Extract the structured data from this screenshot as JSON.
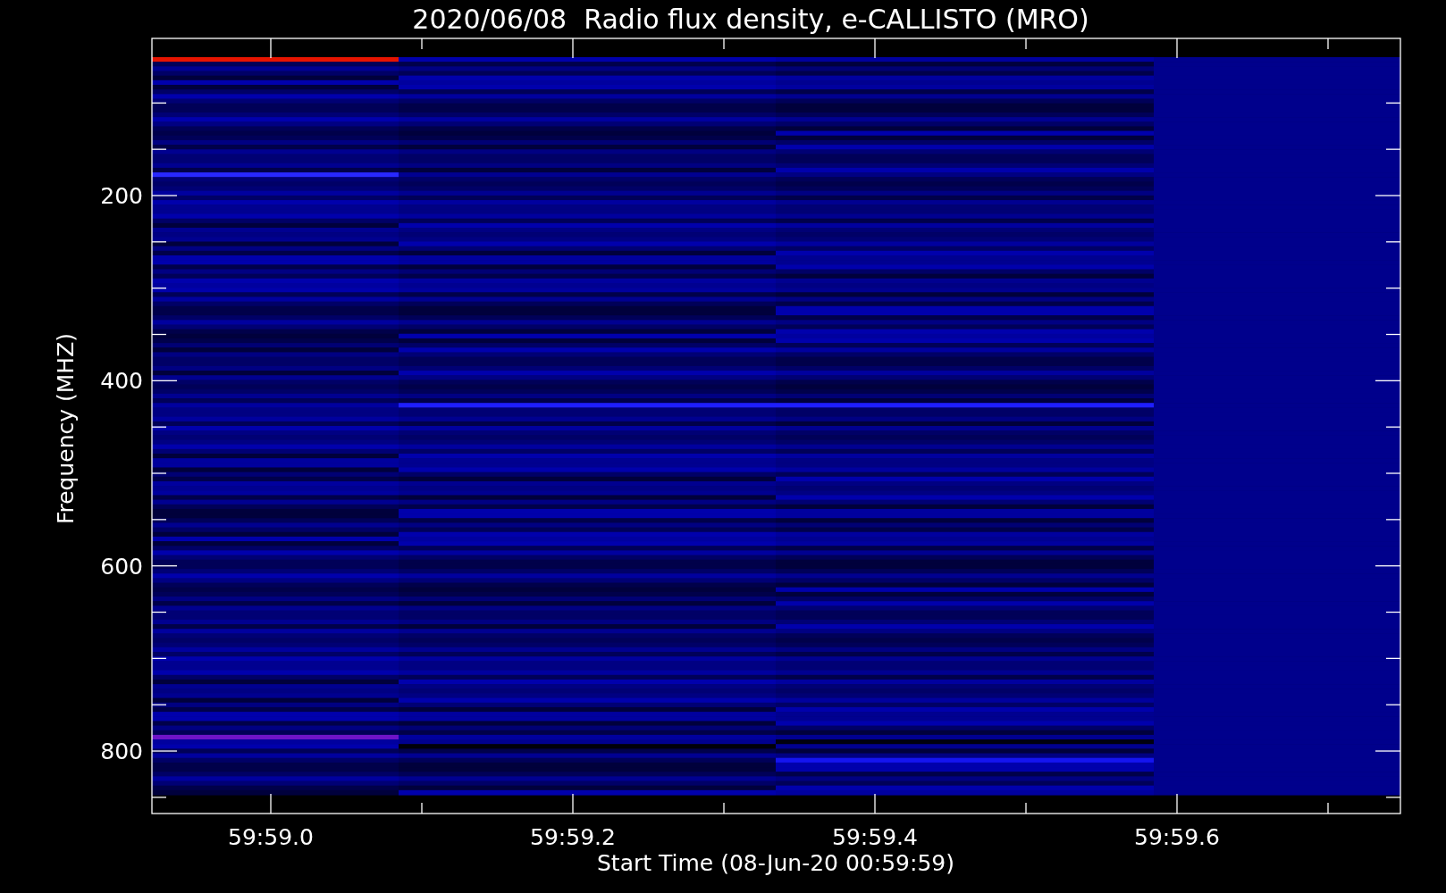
{
  "title": "2020/06/08  Radio flux density, e-CALLISTO (MRO)",
  "plot": {
    "ylabel": "Frequency (MHZ)",
    "xlabel": "Start Time (08-Jun-20 00:59:59)",
    "yticks": [
      "200",
      "400",
      "600",
      "800"
    ],
    "xticks": [
      "59:59.0",
      "59:59.2",
      "59:59.4",
      "59:59.6"
    ]
  }
}
